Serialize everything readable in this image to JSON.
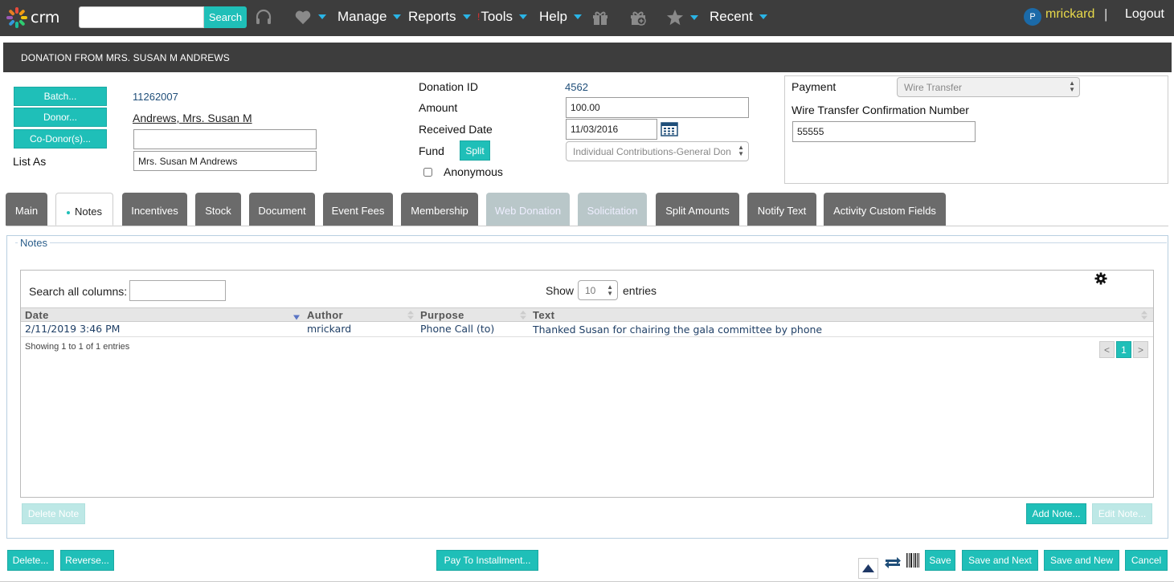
{
  "nav": {
    "logo_text": "crm",
    "search_button": "Search",
    "menus": [
      {
        "label": "Manage"
      },
      {
        "label": "Reports"
      },
      {
        "label": "Tools"
      },
      {
        "label": "Help"
      },
      {
        "label": "Recent"
      }
    ],
    "user_initial": "P",
    "username": "mrickard",
    "separator": "|",
    "logout": "Logout",
    "accent_color": "#1fbfb8"
  },
  "page_title": "DONATION FROM MRS. SUSAN M ANDREWS",
  "header": {
    "batch_button": "Batch...",
    "batch_value": "11262007",
    "donor_button": "Donor...",
    "donor_value": "Andrews, Mrs. Susan M",
    "codonor_button": "Co-Donor(s)...",
    "codonor_value": "",
    "list_as_label": "List As",
    "list_as_value": "Mrs. Susan M Andrews",
    "donation_id_label": "Donation ID",
    "donation_id_value": "4562",
    "amount_label": "Amount",
    "amount_value": "100.00",
    "received_date_label": "Received Date",
    "received_date_value": "11/03/2016",
    "fund_label": "Fund",
    "split_button": "Split",
    "fund_value": "Individual Contributions-General Don",
    "anonymous_label": "Anonymous",
    "payment_label": "Payment",
    "payment_value": "Wire Transfer",
    "wire_label": "Wire Transfer Confirmation Number",
    "wire_value": "55555"
  },
  "tabs": [
    {
      "label": "Main"
    },
    {
      "label": "Notes"
    },
    {
      "label": "Incentives"
    },
    {
      "label": "Stock"
    },
    {
      "label": "Document"
    },
    {
      "label": "Event Fees"
    },
    {
      "label": "Membership"
    },
    {
      "label": "Web Donation"
    },
    {
      "label": "Solicitation"
    },
    {
      "label": "Split Amounts"
    },
    {
      "label": "Notify Text"
    },
    {
      "label": "Activity Custom Fields"
    }
  ],
  "notes": {
    "legend": "Notes",
    "search_label": "Search all columns:",
    "show_label": "Show",
    "show_value": "10",
    "entries_label": "entries",
    "columns": [
      "Date",
      "Author",
      "Purpose",
      "Text"
    ],
    "rows": [
      {
        "date": "2/11/2019 3:46 PM",
        "author": "mrickard",
        "purpose": "Phone Call (to)",
        "text": "Thanked Susan for chairing the gala committee by phone"
      }
    ],
    "showing": "Showing 1 to 1 of 1 entries",
    "pager": {
      "prev": "<",
      "current": "1",
      "next": ">"
    },
    "delete_note": "Delete Note",
    "add_note": "Add Note...",
    "edit_note": "Edit Note..."
  },
  "footer": {
    "delete": "Delete...",
    "reverse": "Reverse...",
    "pay_installment": "Pay To Installment...",
    "save": "Save",
    "save_next": "Save and Next",
    "save_new": "Save and New",
    "cancel": "Cancel"
  }
}
